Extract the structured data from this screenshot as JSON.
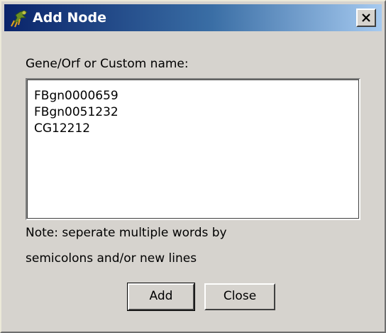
{
  "window": {
    "title": "Add Node",
    "icon": "app-icon"
  },
  "form": {
    "prompt_label": "Gene/Orf or Custom name:",
    "names": [
      "FBgn0000659",
      "FBgn0051232",
      "CG12212"
    ],
    "note_line1": "Note: seperate multiple words by",
    "note_line2": "semicolons and/or new lines"
  },
  "buttons": {
    "add_label": "Add",
    "close_label": "Close"
  },
  "colors": {
    "titlebar_start": "#0a246a",
    "titlebar_end": "#a6caf0",
    "dialog_bg": "#d6d3ce"
  }
}
